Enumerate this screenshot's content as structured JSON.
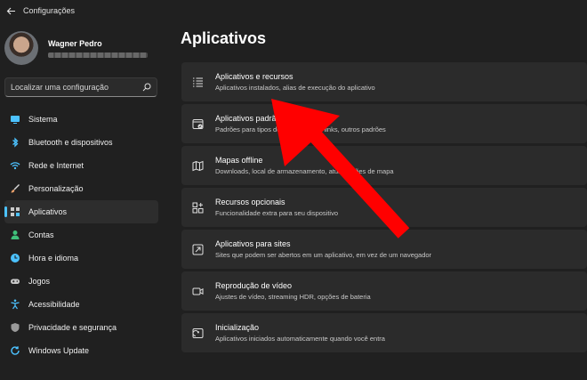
{
  "window": {
    "title": "Configurações"
  },
  "profile": {
    "name": "Wagner Pedro"
  },
  "search": {
    "placeholder": "Localizar uma configuração"
  },
  "sidebar": {
    "items": [
      {
        "label": "Sistema",
        "icon": "monitor-icon",
        "color": "#4cc2ff"
      },
      {
        "label": "Bluetooth e dispositivos",
        "icon": "bluetooth-icon",
        "color": "#4cc2ff"
      },
      {
        "label": "Rede e Internet",
        "icon": "wifi-icon",
        "color": "#4cc2ff"
      },
      {
        "label": "Personalização",
        "icon": "brush-icon",
        "color": "#e8a06a"
      },
      {
        "label": "Aplicativos",
        "icon": "apps-icon",
        "color": "#c9c9c9",
        "active": true
      },
      {
        "label": "Contas",
        "icon": "person-icon",
        "color": "#3fc07a"
      },
      {
        "label": "Hora e idioma",
        "icon": "globe-clock-icon",
        "color": "#4cc2ff"
      },
      {
        "label": "Jogos",
        "icon": "gamepad-icon",
        "color": "#c9c9c9"
      },
      {
        "label": "Acessibilidade",
        "icon": "accessibility-icon",
        "color": "#4cc2ff"
      },
      {
        "label": "Privacidade e segurança",
        "icon": "shield-icon",
        "color": "#c9c9c9"
      },
      {
        "label": "Windows Update",
        "icon": "update-icon",
        "color": "#4cc2ff"
      }
    ]
  },
  "main": {
    "title": "Aplicativos",
    "cards": [
      {
        "title": "Aplicativos e recursos",
        "desc": "Aplicativos instalados, alias de execução do aplicativo",
        "icon": "list-icon"
      },
      {
        "title": "Aplicativos padrão",
        "desc": "Padrões para tipos de arquivos e de links, outros padrões",
        "icon": "default-apps-icon"
      },
      {
        "title": "Mapas offline",
        "desc": "Downloads, local de armazenamento, atualizações de mapa",
        "icon": "map-icon"
      },
      {
        "title": "Recursos opcionais",
        "desc": "Funcionalidade extra para seu dispositivo",
        "icon": "add-grid-icon"
      },
      {
        "title": "Aplicativos para sites",
        "desc": "Sites que podem ser abertos em um aplicativo, em vez de um navegador",
        "icon": "open-link-icon"
      },
      {
        "title": "Reprodução de vídeo",
        "desc": "Ajustes de vídeo, streaming HDR, opções de bateria",
        "icon": "video-icon"
      },
      {
        "title": "Inicialização",
        "desc": "Aplicativos iniciados automaticamente quando você entra",
        "icon": "startup-icon"
      }
    ]
  },
  "annotation": {
    "color": "#ff0000"
  }
}
